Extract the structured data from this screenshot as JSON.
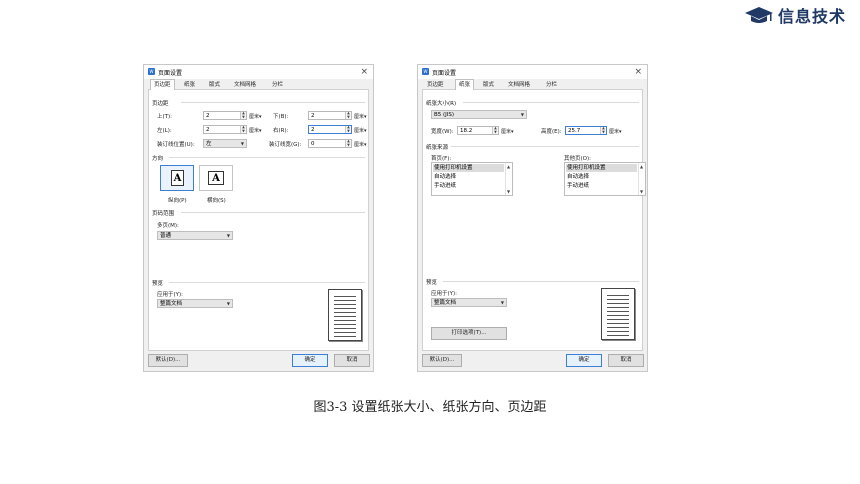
{
  "badge": {
    "label": "信息技术",
    "icon": "graduation-cap-icon",
    "color": "#1f3864"
  },
  "caption": "图3-3 设置纸张大小、纸张方向、页边距",
  "left_dialog": {
    "title": "页面设置",
    "close": "×",
    "tabs": [
      "页边距",
      "纸张",
      "版式",
      "文档网格",
      "分栏"
    ],
    "active_tab": "页边距",
    "margins": {
      "section": "页边距",
      "top_label": "上(T):",
      "top_value": "2",
      "bottom_label": "下(B):",
      "bottom_value": "2",
      "left_label": "左(L):",
      "left_value": "2",
      "right_label": "右(R):",
      "right_value": "2",
      "unit": "厘米▾",
      "gutter_pos_label": "装订线位置(U):",
      "gutter_pos_value": "左",
      "gutter_width_label": "装订线宽(G):",
      "gutter_width_value": "0"
    },
    "orientation": {
      "section": "方向",
      "portrait": "纵向(P)",
      "landscape": "横向(S)",
      "glyph": "A"
    },
    "pages": {
      "section": "页码范围",
      "multi_label": "多页(M):",
      "multi_value": "普通"
    },
    "preview": {
      "section": "预览",
      "apply_label": "应用于(Y):",
      "apply_value": "整篇文档"
    },
    "buttons": {
      "default": "默认(D)...",
      "ok": "确定",
      "cancel": "取消"
    }
  },
  "right_dialog": {
    "title": "页面设置",
    "close": "×",
    "tabs": [
      "页边距",
      "纸张",
      "版式",
      "文档网格",
      "分栏"
    ],
    "active_tab": "纸张",
    "paper_size": {
      "section": "纸张大小(R)",
      "size_value": "B5 (JIS)",
      "width_label": "宽度(W):",
      "width_value": "18.2",
      "height_label": "高度(E):",
      "height_value": "25.7",
      "unit": "厘米▾"
    },
    "paper_source": {
      "section": "纸张来源",
      "first_label": "首页(F):",
      "other_label": "其他页(O):",
      "items": [
        "使用打印机设置",
        "自动选择",
        "手动进纸"
      ]
    },
    "preview": {
      "section": "预览",
      "apply_label": "应用于(Y):",
      "apply_value": "整篇文档",
      "print_options": "打印选项(T)..."
    },
    "buttons": {
      "default": "默认(D)...",
      "ok": "确定",
      "cancel": "取消"
    }
  }
}
